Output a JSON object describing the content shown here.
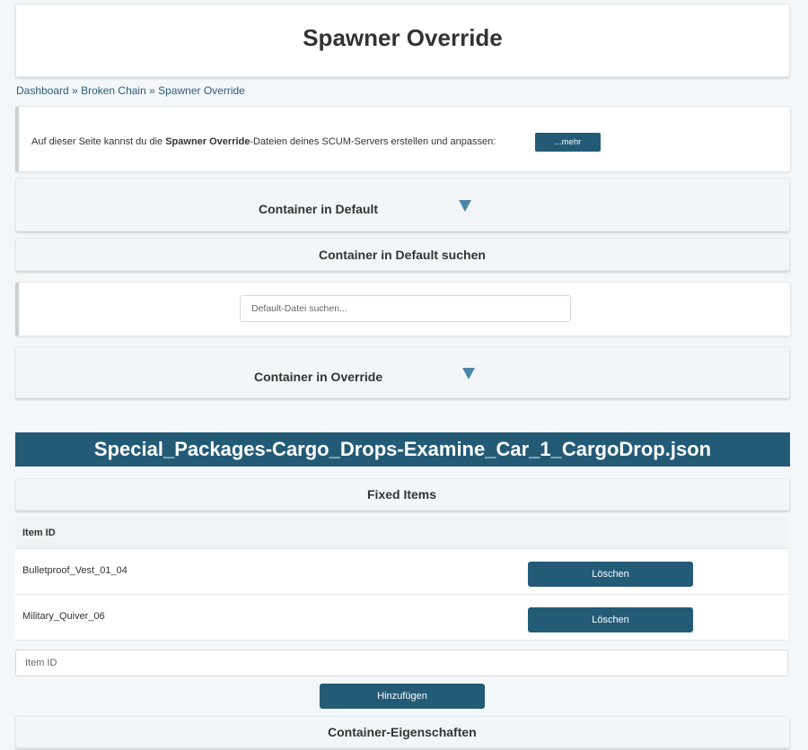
{
  "page": {
    "title": "Spawner Override"
  },
  "breadcrumb": {
    "items": [
      "Dashboard",
      "Broken Chain",
      "Spawner Override"
    ],
    "separator": " » "
  },
  "info": {
    "text_before": "Auf dieser Seite kannst du die ",
    "text_bold": "Spawner Override",
    "text_after": "-Dateien deines SCUM-Servers erstellen und anpassen:",
    "more_label": "...mehr"
  },
  "sections": {
    "default_container": "Container in Default",
    "default_search": "Container in Default suchen",
    "override_container": "Container in Override",
    "fixed_items": "Fixed Items",
    "container_properties": "Container-Eigenschaften"
  },
  "search": {
    "placeholder": "Default-Datei suchen..."
  },
  "file": {
    "name": "Special_Packages-Cargo_Drops-Examine_Car_1_CargoDrop.json"
  },
  "table": {
    "header_item_id": "Item ID",
    "rows": [
      {
        "item_id": "Bulletproof_Vest_01_04",
        "action_label": "Löschen"
      },
      {
        "item_id": "Military_Quiver_06",
        "action_label": "Löschen"
      }
    ]
  },
  "add_item": {
    "placeholder": "Item ID",
    "button_label": "Hinzufügen"
  },
  "colors": {
    "accent": "#235b77",
    "toggle_arrow": "#4a87a7",
    "background": "#f4f7f9"
  },
  "icons": {
    "toggle": "triangle-down-icon"
  }
}
